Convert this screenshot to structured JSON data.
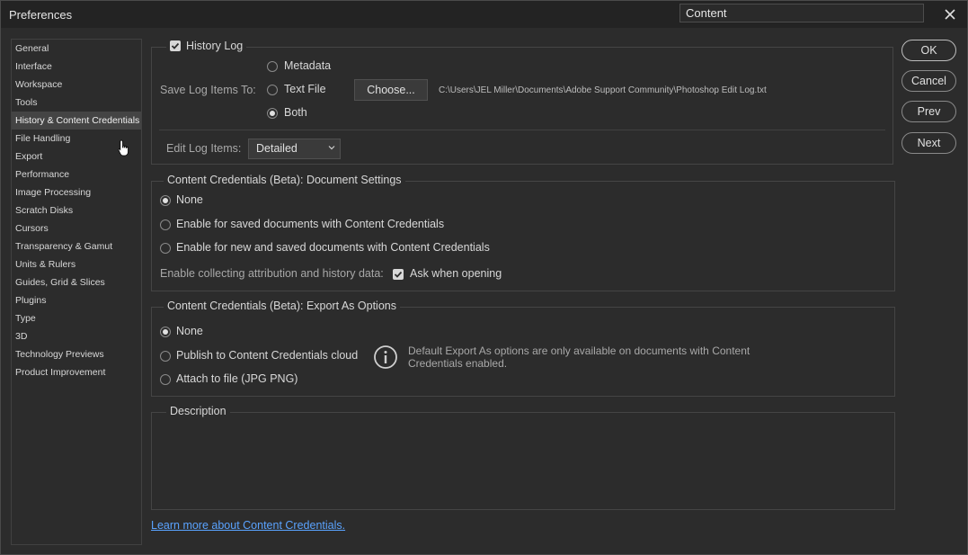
{
  "window": {
    "title": "Preferences",
    "search_value": "Content"
  },
  "sidebar": {
    "items": [
      {
        "label": "General"
      },
      {
        "label": "Interface"
      },
      {
        "label": "Workspace"
      },
      {
        "label": "Tools"
      },
      {
        "label": "History & Content Credentials",
        "selected": true
      },
      {
        "label": "File Handling"
      },
      {
        "label": "Export"
      },
      {
        "label": "Performance"
      },
      {
        "label": "Image Processing"
      },
      {
        "label": "Scratch Disks"
      },
      {
        "label": "Cursors"
      },
      {
        "label": "Transparency & Gamut"
      },
      {
        "label": "Units & Rulers"
      },
      {
        "label": "Guides, Grid & Slices"
      },
      {
        "label": "Plugins"
      },
      {
        "label": "Type"
      },
      {
        "label": "3D"
      },
      {
        "label": "Technology Previews"
      },
      {
        "label": "Product Improvement"
      }
    ]
  },
  "history_log": {
    "checkbox_label": "History Log",
    "checked": true,
    "save_label": "Save Log Items To:",
    "options": [
      {
        "label": "Metadata",
        "selected": false
      },
      {
        "label": "Text File",
        "selected": false
      },
      {
        "label": "Both",
        "selected": true
      }
    ],
    "choose_button": "Choose...",
    "log_path": "C:\\Users\\JEL Miller\\Documents\\Adobe Support Community\\Photoshop Edit Log.txt",
    "edit_label": "Edit Log Items:",
    "edit_value": "Detailed"
  },
  "doc_settings": {
    "legend": "Content Credentials (Beta): Document Settings",
    "options": [
      {
        "label": "None",
        "selected": true
      },
      {
        "label": "Enable for saved documents with Content Credentials",
        "selected": false
      },
      {
        "label": "Enable for new and saved documents with Content Credentials",
        "selected": false
      }
    ],
    "collect_label": "Enable collecting attribution and history data:",
    "ask_label": "Ask when opening",
    "ask_checked": true
  },
  "export_options": {
    "legend": "Content Credentials (Beta): Export As Options",
    "options": [
      {
        "label": "None",
        "selected": true
      },
      {
        "label": "Publish to Content Credentials cloud",
        "selected": false
      },
      {
        "label": "Attach to file (JPG  PNG)",
        "selected": false
      }
    ],
    "info_line1": "Default Export As options are only available on documents with Content",
    "info_line2": "Credentials enabled."
  },
  "description": {
    "legend": "Description"
  },
  "learn_more": "Learn more about Content Credentials.",
  "buttons": {
    "ok": "OK",
    "cancel": "Cancel",
    "prev": "Prev",
    "next": "Next"
  },
  "colors": {
    "background": "#2c2c2c",
    "link": "#5aa3ff",
    "selected_item": "#444444"
  }
}
